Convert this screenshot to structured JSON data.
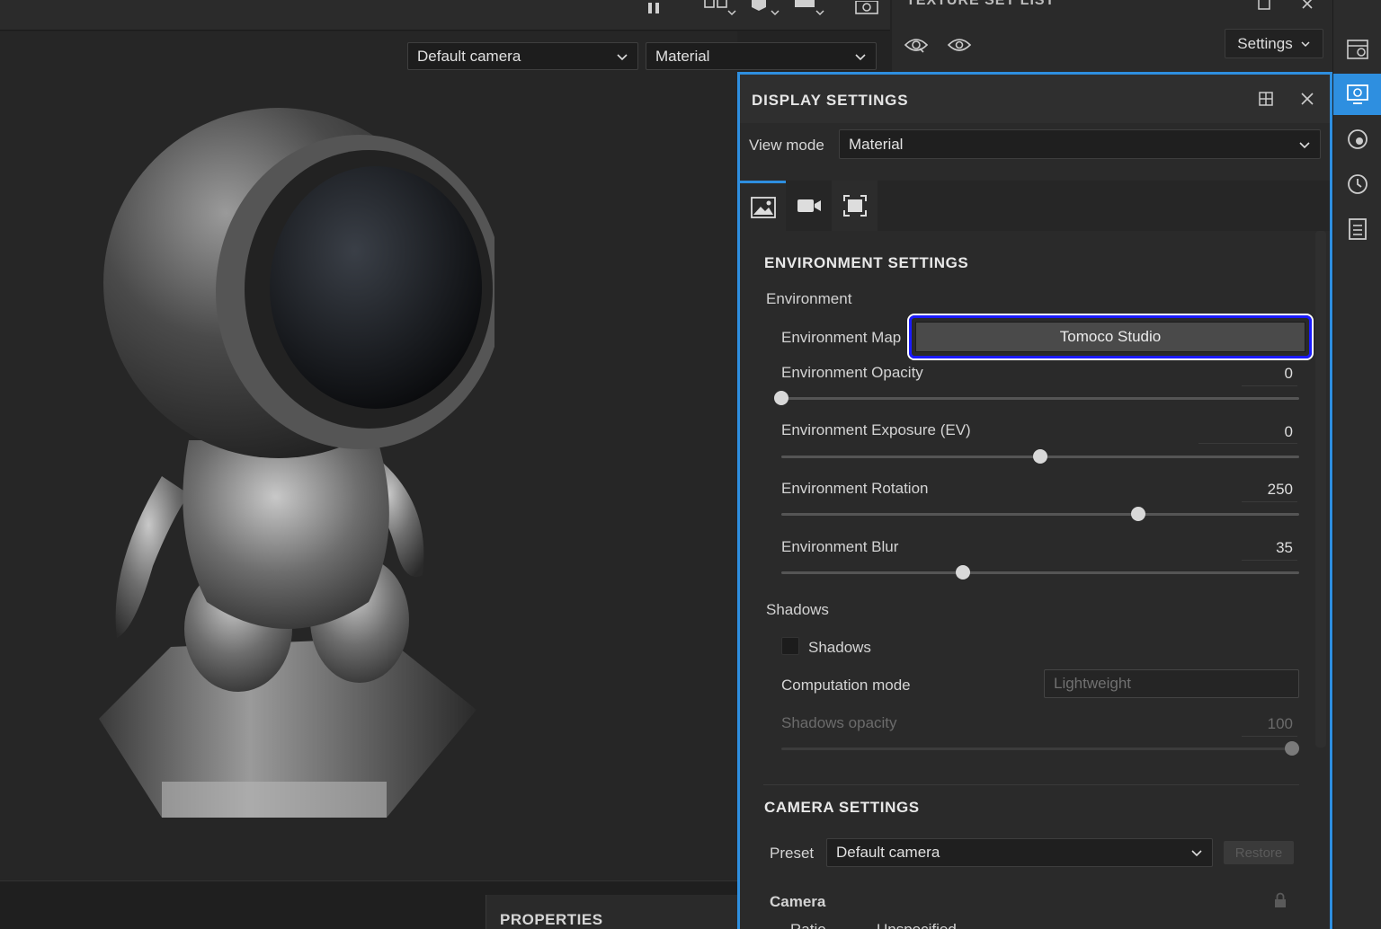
{
  "viewport": {
    "camera_select": "Default camera",
    "mode_select": "Material"
  },
  "texture_set_list": {
    "title": "TEXTURE SET LIST",
    "settings_label": "Settings"
  },
  "display_settings": {
    "title": "DISPLAY SETTINGS",
    "view_mode_label": "View mode",
    "view_mode_value": "Material",
    "environment_settings": {
      "title": "ENVIRONMENT SETTINGS",
      "group_label": "Environment",
      "env_map_label": "Environment Map",
      "env_map_value": "Tomoco Studio",
      "opacity": {
        "label": "Environment Opacity",
        "value": "0",
        "fraction": 0.0
      },
      "exposure": {
        "label": "Environment Exposure (EV)",
        "value": "0",
        "fraction": 0.5
      },
      "rotation": {
        "label": "Environment Rotation",
        "value": "250",
        "fraction": 0.69
      },
      "blur": {
        "label": "Environment Blur",
        "value": "35",
        "fraction": 0.35
      }
    },
    "shadows": {
      "group_label": "Shadows",
      "checkbox_label": "Shadows",
      "computation_mode_label": "Computation mode",
      "computation_mode_value": "Lightweight",
      "opacity_label": "Shadows opacity",
      "opacity_value": "100",
      "opacity_fraction": 1.0
    },
    "camera_settings": {
      "title": "CAMERA SETTINGS",
      "preset_label": "Preset",
      "preset_value": "Default camera",
      "restore_label": "Restore",
      "camera_label": "Camera",
      "ratio_label": "Ratio",
      "ratio_value": "Unspecified"
    }
  },
  "bottom_dock": {
    "properties_label": "PROPERTIES"
  },
  "colors": {
    "accent": "#2e8fe0",
    "highlight_border": "#1a1aff"
  }
}
